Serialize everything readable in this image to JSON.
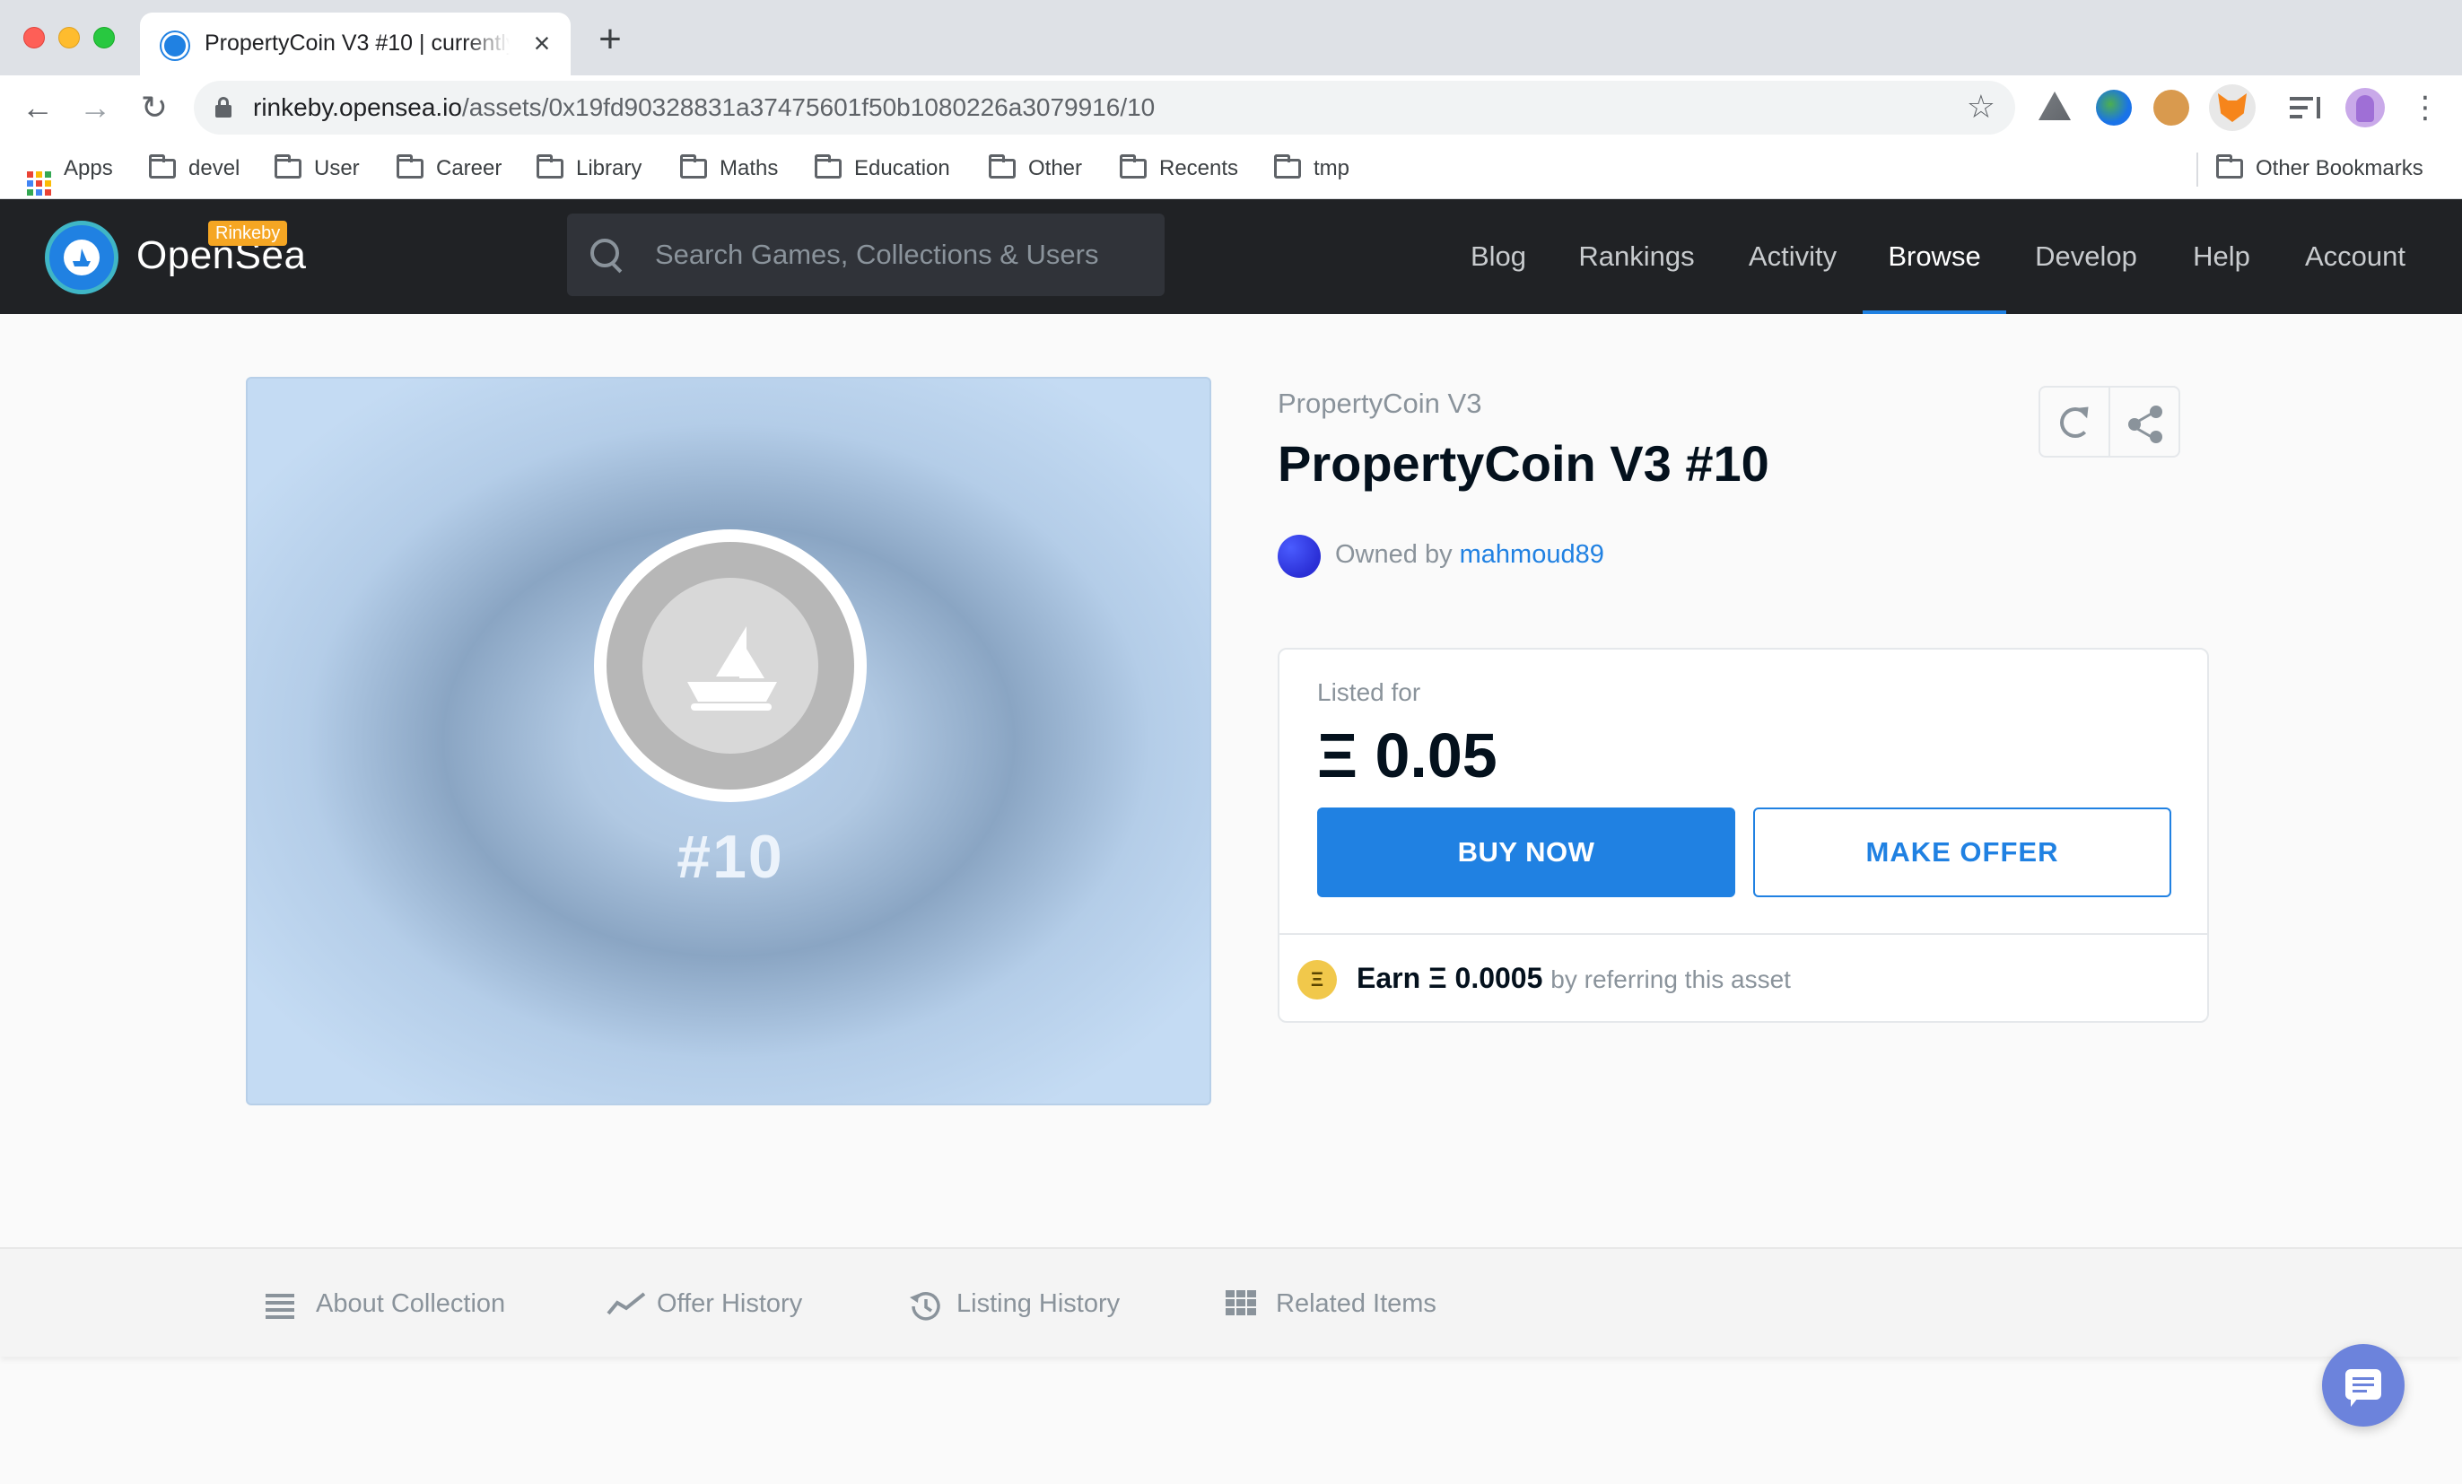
{
  "browser": {
    "tab_title": "PropertyCoin V3 #10 | currently on sale",
    "url_host": "rinkeby.opensea.io",
    "url_path": "/assets/0x19fd90328831a37475601f50b1080226a3079916/10",
    "bookmarks": [
      {
        "label": "Apps",
        "icon": "apps-grid-icon"
      },
      {
        "label": "devel",
        "icon": "folder-icon"
      },
      {
        "label": "User",
        "icon": "folder-icon"
      },
      {
        "label": "Career",
        "icon": "folder-icon"
      },
      {
        "label": "Library",
        "icon": "folder-icon"
      },
      {
        "label": "Maths",
        "icon": "folder-icon"
      },
      {
        "label": "Education",
        "icon": "folder-icon"
      },
      {
        "label": "Other",
        "icon": "folder-icon"
      },
      {
        "label": "Recents",
        "icon": "folder-icon"
      },
      {
        "label": "tmp",
        "icon": "folder-icon"
      }
    ],
    "other_bookmarks": "Other Bookmarks"
  },
  "header": {
    "brand": "OpenSea",
    "network_badge": "Rinkeby",
    "search_placeholder": "Search Games, Collections & Users",
    "nav": [
      "Blog",
      "Rankings",
      "Activity",
      "Browse",
      "Develop",
      "Help",
      "Account"
    ],
    "active_nav": "Browse",
    "accent_color": "#2081e2"
  },
  "asset": {
    "image_label": "#10",
    "collection": "PropertyCoin V3",
    "title": "PropertyCoin V3 #10",
    "owned_by_prefix": "Owned by",
    "owner": "mahmoud89",
    "listed_for_label": "Listed for",
    "price": "Ξ 0.05",
    "buy_label": "BUY NOW",
    "offer_label": "MAKE OFFER",
    "referral": {
      "coin_symbol": "Ξ",
      "earn": "Earn Ξ 0.0005",
      "suffix": "by referring this asset"
    }
  },
  "bottom_tabs": [
    {
      "label": "About Collection",
      "icon": "list-icon"
    },
    {
      "label": "Offer History",
      "icon": "trend-chart-icon"
    },
    {
      "label": "Listing History",
      "icon": "history-icon"
    },
    {
      "label": "Related Items",
      "icon": "grid-icon"
    }
  ]
}
